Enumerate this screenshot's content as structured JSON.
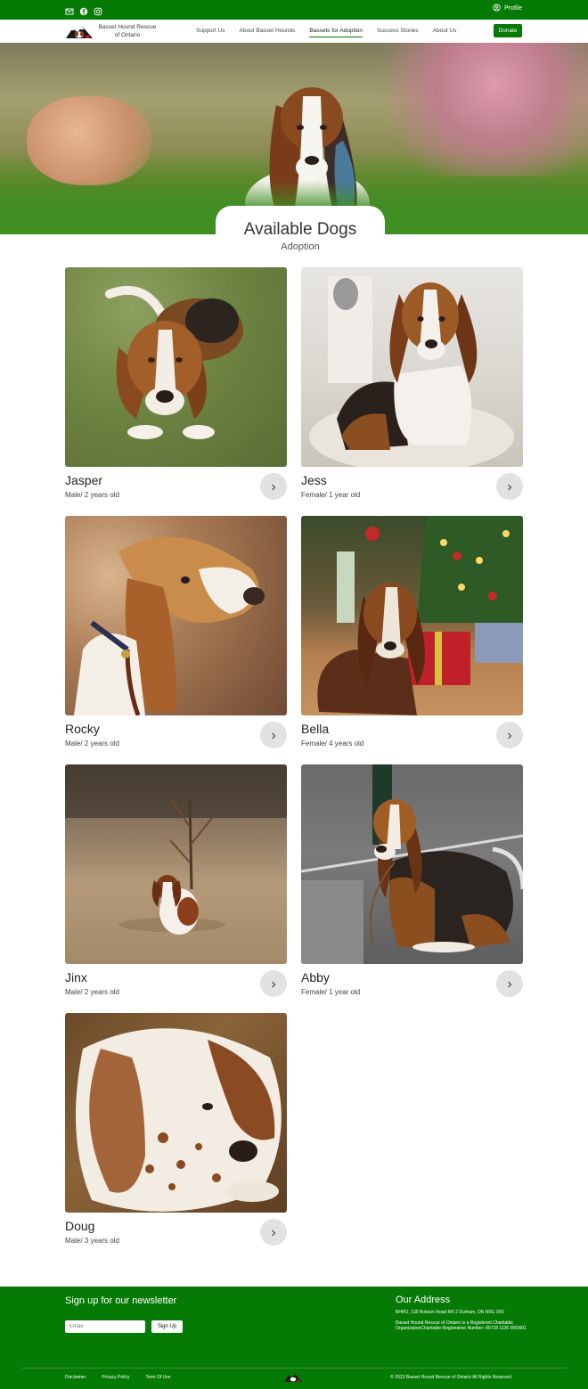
{
  "topbar": {
    "icons": [
      "mail-icon",
      "facebook-icon",
      "instagram-icon"
    ],
    "profile_label": "Profile"
  },
  "nav": {
    "brand": "Basset Hound Rescue of Ontario",
    "links": [
      "Support Us",
      "About Basset Hounds",
      "Bassets for Adoption",
      "Success Stories",
      "About Us"
    ],
    "active_link": "Bassets for Adoption",
    "donate_label": "Donate"
  },
  "hero": {
    "title": "Available Dogs",
    "subtitle": "Adoption"
  },
  "dogs": [
    {
      "name": "Jasper",
      "meta": "Male/ 2 years old"
    },
    {
      "name": "Jess",
      "meta": "Female/ 1 year old"
    },
    {
      "name": "Rocky",
      "meta": "Male/ 2 years old"
    },
    {
      "name": "Bella",
      "meta": "Female/ 4 years old"
    },
    {
      "name": "Jinx",
      "meta": "Male/ 2 years old"
    },
    {
      "name": "Abby",
      "meta": "Female/ 1 year old"
    },
    {
      "name": "Doug",
      "meta": "Male/ 3 years old"
    }
  ],
  "footer": {
    "newsletter_title": "Sign up for our newsletter",
    "email_placeholder": "Email",
    "signup_label": "Sign Up",
    "address_title": "Our Address",
    "address_line": "BHRO, 118 Robson Road RR 2 Durham, ON N0G 1R0",
    "charity_line": "Basset Hound Rescue of Ontario is a Registered Charitable OrganizationCharitable Registration Number: 85718 1135 RR0001",
    "links": [
      "Disclaimer",
      "Privacy Policy",
      "Term Of Use"
    ],
    "copyright": "© 2023 Basset Hound Rescue of Ontario All Rights Reserved"
  },
  "colors": {
    "brand_green": "#057b05"
  }
}
